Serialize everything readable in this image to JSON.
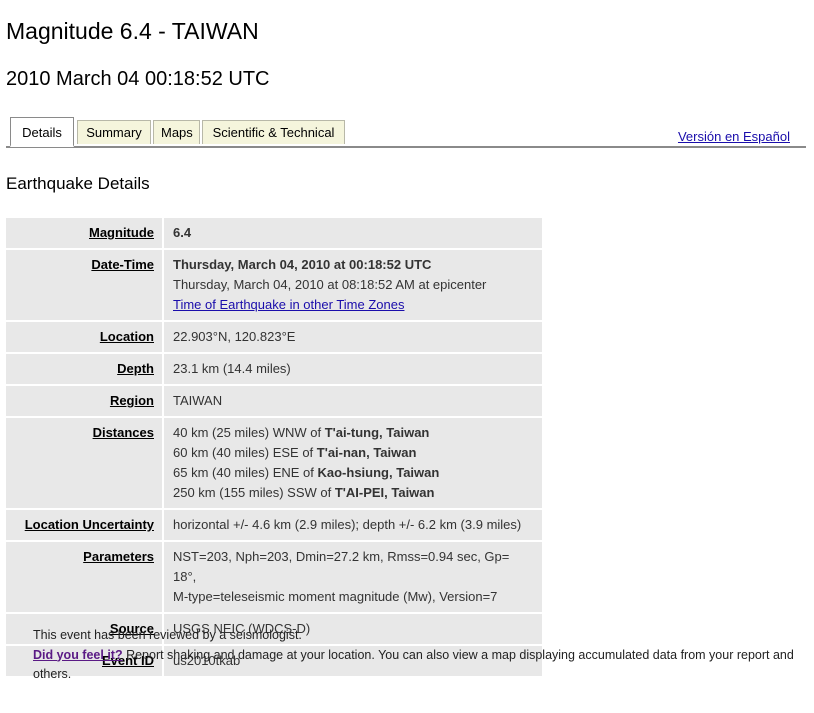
{
  "header": {
    "title": "Magnitude 6.4 - TAIWAN",
    "subtitle": "2010 March 04 00:18:52 UTC"
  },
  "tabs": [
    {
      "label": "Details",
      "active": true
    },
    {
      "label": "Summary",
      "active": false
    },
    {
      "label": "Maps",
      "active": false
    },
    {
      "label": "Scientific & Technical",
      "active": false
    }
  ],
  "lang_link": "Versión en Español",
  "section_heading": "Earthquake Details",
  "details": {
    "magnitude": {
      "label": "Magnitude",
      "value": "6.4"
    },
    "datetime": {
      "label": "Date-Time",
      "utc": "Thursday, March 04, 2010 at 00:18:52 UTC",
      "local": "Thursday, March 04, 2010 at 08:18:52 AM at epicenter",
      "link": "Time of Earthquake in other Time Zones"
    },
    "location": {
      "label": "Location",
      "value": "22.903°N, 120.823°E"
    },
    "depth": {
      "label": "Depth",
      "value": "23.1 km (14.4 miles)"
    },
    "region": {
      "label": "Region",
      "value": "TAIWAN"
    },
    "distances": {
      "label": "Distances",
      "items": [
        {
          "text": "40 km (25 miles) WNW of ",
          "place": "T'ai-tung, Taiwan"
        },
        {
          "text": "60 km (40 miles) ESE of ",
          "place": "T'ai-nan, Taiwan"
        },
        {
          "text": "65 km (40 miles) ENE of ",
          "place": "Kao-hsiung, Taiwan"
        },
        {
          "text": "250 km (155 miles) SSW of ",
          "place": "T'AI-PEI, Taiwan"
        }
      ]
    },
    "uncertainty": {
      "label": "Location Uncertainty",
      "value": "horizontal +/- 4.6 km (2.9 miles); depth +/- 6.2 km (3.9 miles)"
    },
    "parameters": {
      "label": "Parameters",
      "line1": "NST=203, Nph=203, Dmin=27.2 km, Rmss=0.94 sec, Gp= 18°,",
      "line2": "M-type=teleseismic moment magnitude (Mw), Version=7"
    },
    "source": {
      "label": "Source",
      "value": "USGS NEIC (WDCS-D)"
    },
    "event_id": {
      "label": "Event ID",
      "value": "us2010tkab"
    }
  },
  "footer": {
    "reviewed": "This event has been reviewed by a seismologist.",
    "feel_link": "Did you feel it?",
    "feel_text": " Report shaking and damage at your location. You can also view a map displaying accumulated data from your report and others."
  }
}
